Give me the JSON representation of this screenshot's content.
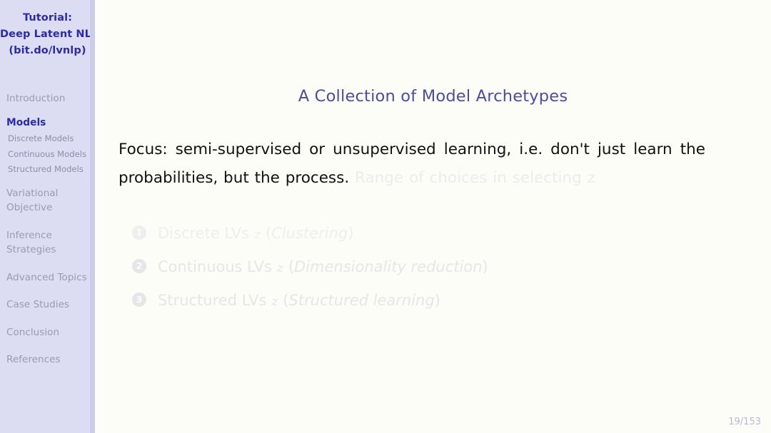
{
  "slide": {
    "title": "A Collection of Model Archetypes",
    "page_number": "19/153",
    "accent_color": "#4b4ba8",
    "sidebar_bg": "#dcdcf2",
    "content_bg": "#fcfdf7"
  },
  "sidebar": {
    "title_lines": [
      "Tutorial:",
      "Deep Latent NLP",
      "(bit.do/lvnlp)"
    ],
    "items": [
      {
        "label": "Introduction",
        "state": "inactive"
      },
      {
        "label": "Models",
        "state": "current"
      },
      {
        "label": "Variational Objective",
        "state": "inactive"
      },
      {
        "label": "Inference Strategies",
        "state": "inactive"
      },
      {
        "label": "Advanced Topics",
        "state": "inactive"
      },
      {
        "label": "Case Studies",
        "state": "inactive"
      },
      {
        "label": "Conclusion",
        "state": "inactive"
      },
      {
        "label": "References",
        "state": "inactive"
      }
    ],
    "subitems": [
      {
        "label": "Discrete Models"
      },
      {
        "label": "Continuous Models"
      },
      {
        "label": "Structured Models"
      }
    ]
  },
  "body": {
    "paragraph_visible": "Focus: semi-supervised or unsupervised learning, i.e. don't just learn the probabilities, but the process.",
    "paragraph_faded": "Range of choices in selecting z"
  },
  "archetypes": [
    {
      "number": "1",
      "prefix": "Discrete LVs",
      "variable": "z",
      "open_paren": "(",
      "description": "Clustering",
      "close_paren": ")",
      "opacity_level": "faintest"
    },
    {
      "number": "2",
      "prefix": "Continuous LVs",
      "variable": "z",
      "open_paren": "(",
      "description": "Dimensionality reduction",
      "close_paren": ")",
      "opacity_level": "faint"
    },
    {
      "number": "3",
      "prefix": "Structured LVs",
      "variable": "z",
      "open_paren": "(",
      "description": "Structured learning",
      "close_paren": ")",
      "opacity_level": "faint"
    }
  ]
}
